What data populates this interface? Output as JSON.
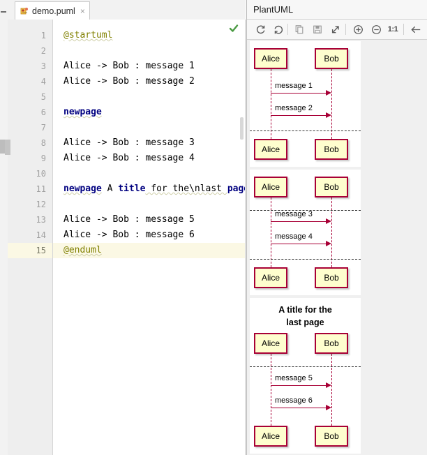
{
  "window": {
    "left_rail": {
      "collapse_icon": "collapse-dash-icon",
      "handle": "splitter-handle"
    }
  },
  "editor": {
    "tab": {
      "label": "demo.puml",
      "close": "×",
      "icon": "puml-file-icon"
    },
    "inspection_icon": "green-check-inspection-icon",
    "line_numbers": [
      "1",
      "2",
      "3",
      "4",
      "5",
      "6",
      "7",
      "8",
      "9",
      "10",
      "11",
      "12",
      "13",
      "14",
      "15"
    ],
    "current_line": 15,
    "lines": [
      {
        "n": 1,
        "segments": [
          {
            "text": "@startuml",
            "style": "meta wavy"
          }
        ]
      },
      {
        "n": 2,
        "segments": []
      },
      {
        "n": 3,
        "segments": [
          {
            "text": "Alice -> Bob : message 1",
            "style": "plain"
          }
        ]
      },
      {
        "n": 4,
        "segments": [
          {
            "text": "Alice -> Bob : message 2",
            "style": "plain"
          }
        ]
      },
      {
        "n": 5,
        "segments": []
      },
      {
        "n": 6,
        "segments": [
          {
            "text": "newpage",
            "style": "kw wavy"
          }
        ]
      },
      {
        "n": 7,
        "segments": []
      },
      {
        "n": 8,
        "segments": [
          {
            "text": "Alice -> Bob : message 3",
            "style": "plain"
          }
        ]
      },
      {
        "n": 9,
        "segments": [
          {
            "text": "Alice -> Bob : message 4",
            "style": "plain"
          }
        ]
      },
      {
        "n": 10,
        "segments": []
      },
      {
        "n": 11,
        "segments": [
          {
            "text": "newpage",
            "style": "kw wavy"
          },
          {
            "text": " A ",
            "style": "plain"
          },
          {
            "text": "title",
            "style": "kw"
          },
          {
            "text": " for the\\nlast ",
            "style": "plain wavy"
          },
          {
            "text": "page",
            "style": "kw"
          }
        ]
      },
      {
        "n": 12,
        "segments": []
      },
      {
        "n": 13,
        "segments": [
          {
            "text": "Alice -> Bob : message 5",
            "style": "plain"
          }
        ]
      },
      {
        "n": 14,
        "segments": [
          {
            "text": "Alice -> Bob : message 6",
            "style": "plain"
          }
        ]
      },
      {
        "n": 15,
        "segments": [
          {
            "text": "@enduml",
            "style": "meta wavy"
          }
        ]
      }
    ]
  },
  "preview": {
    "title": "PlantUML",
    "toolbar": [
      {
        "name": "refresh-button",
        "glyph": "refresh"
      },
      {
        "name": "reload-button",
        "glyph": "reload"
      },
      {
        "name": "copy-button",
        "glyph": "copy"
      },
      {
        "name": "save-button",
        "glyph": "save"
      },
      {
        "name": "open-external-button",
        "glyph": "external"
      },
      {
        "name": "zoom-in-button",
        "glyph": "plus-circle"
      },
      {
        "name": "zoom-out-button",
        "glyph": "minus-circle"
      },
      {
        "name": "zoom-reset-button",
        "glyph": "1:1",
        "label": "1:1"
      },
      {
        "name": "back-button",
        "glyph": "arrow-left"
      }
    ],
    "colors": {
      "box_fill": "#FEFECE",
      "box_border": "#A80036",
      "arrow": "#A80036",
      "page_bg": "#FFFFFF",
      "canvas_bg": "#F0F0F0"
    },
    "pages": [
      {
        "index": 1,
        "title": "",
        "participants": [
          "Alice",
          "Bob"
        ],
        "messages": [
          {
            "label": "message 1",
            "from": "Alice",
            "to": "Bob"
          },
          {
            "label": "message 2",
            "from": "Alice",
            "to": "Bob"
          }
        ],
        "page_breaks_after": 2
      },
      {
        "index": 2,
        "title": "",
        "participants": [
          "Alice",
          "Bob"
        ],
        "messages": [
          {
            "label": "message 3",
            "from": "Alice",
            "to": "Bob"
          },
          {
            "label": "message 4",
            "from": "Alice",
            "to": "Bob"
          }
        ],
        "page_breaks_after": 2
      },
      {
        "index": 3,
        "title": "A title for the last page",
        "title_line1": "A title for the",
        "title_line2": "last page",
        "participants": [
          "Alice",
          "Bob"
        ],
        "messages": [
          {
            "label": "message 5",
            "from": "Alice",
            "to": "Bob"
          },
          {
            "label": "message 6",
            "from": "Alice",
            "to": "Bob"
          }
        ],
        "page_breaks_after": 0
      }
    ]
  }
}
